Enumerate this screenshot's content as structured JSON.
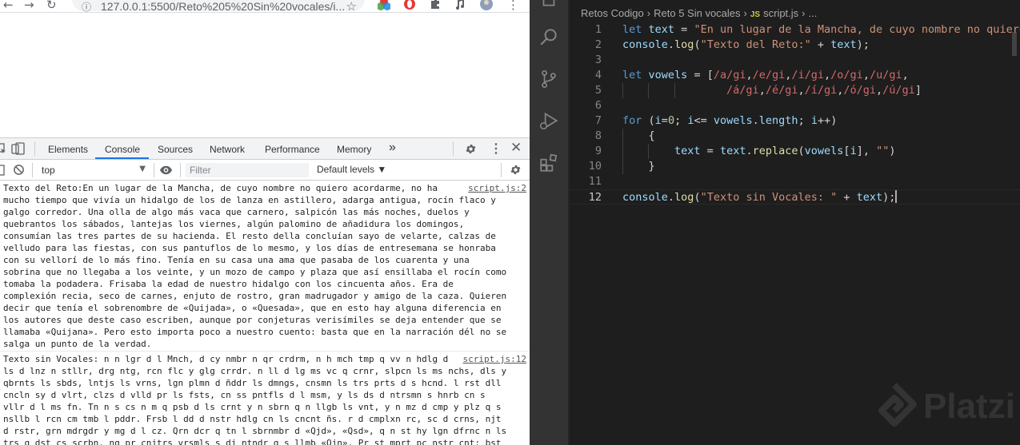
{
  "browser": {
    "url": "127.0.0.1:5500/Reto%205%20Sin%20vocales/i...",
    "colors": {
      "toolbar": "#ffffff",
      "omnibox": "#f1f3f4"
    }
  },
  "devtools": {
    "tabs": [
      "Elements",
      "Console",
      "Sources",
      "Network",
      "Performance",
      "Memory"
    ],
    "active_tab": "Console",
    "more_tabs": "»",
    "context": "top",
    "filter_placeholder": "Filter",
    "levels": "Default levels ▼",
    "accent": "#1a73e8"
  },
  "console": {
    "messages": [
      {
        "source": "script.js:2",
        "text": "Texto del Reto:En un lugar de la Mancha, de cuyo nombre no quiero acordarme, no ha mucho tiempo que vivía un hidalgo de los de lanza en astillero, adarga antigua, rocín flaco y galgo corredor. Una olla de algo más vaca que carnero, salpicón las más noches, duelos y quebrantos los sábados, lantejas los viernes, algún palomino de añadidura los domingos, consumían las tres partes de su hacienda. El resto della concluían sayo de velarte, calzas de velludo para las fiestas, con sus pantuflos de lo mesmo, y los días de entresemana se honraba con su vellorí de lo más fino. Tenía en su casa una ama que pasaba de los cuarenta y una sobrina que no llegaba a los veinte, y un mozo de campo y plaza que así ensillaba el rocín como tomaba la podadera. Frisaba la edad de nuestro hidalgo con los cincuenta años. Era de complexión recia, seco de carnes, enjuto de rostro, gran madrugador y amigo de la caza. Quieren decir que tenía el sobrenombre de «Quijada», o «Quesada», que en esto hay alguna diferencia en los autores que deste caso escriben, aunque por conjeturas verisímiles se deja entender que se llamaba «Quijana». Pero esto importa poco a nuestro cuento: basta que en la narración dél no se salga un punto de la verdad."
      },
      {
        "source": "script.js:12",
        "text": "Texto sin Vocales: n n lgr d l Mnch, d cy nmbr n qr crdrm, n h mch tmp q vv n hdlg d ls d lnz n stllr, drg ntg, rcn flc y glg crrdr. n ll d lg ms vc q crnr, slpcn ls ms nchs, dls y qbrnts ls sbds, lntjs ls vrns, lgn plmn d ñddr ls dmngs, cnsmn ls trs prts d s hcnd. l rst dll cncln sy d vlrt, clzs d vlld pr ls fsts, cn ss pntfls d l msm, y ls ds d ntrsmn s hnrb cn s vllr d l ms fn. Tn n s cs n m q psb d ls crnt y n sbrn q n llgb  ls vnt, y n mz d cmp y plz q s nsllb l rcn cm tmb l pddr. Frsb l dd d nstr hdlg cn ls cncnt ñs. r d cmplxn rc, sc d crns, njt d rstr, grn mdrgdr y mg d l cz. Qrn dcr q tn l sbrnmbr d «Qjd»,  «Qsd», q n st hy lgn dfrnc n ls trs q dst cs scrbn, nq pr cnjtrs vrsmls s dj ntndr q s llmb «Qjn». Pr st mprt pc  nstr cnt: bst q n l nrrcn dl n s slg n pnt d l vrdd."
      }
    ]
  },
  "vscode": {
    "breadcrumbs": [
      "Retos Codigo",
      "Reto 5 Sin vocales",
      "script.js",
      "..."
    ],
    "file_badge": "JS",
    "lines": [
      {
        "n": "1",
        "tokens": [
          [
            "kw",
            "let"
          ],
          [
            "pl",
            " "
          ],
          [
            "var",
            "text"
          ],
          [
            "pl",
            " = "
          ],
          [
            "str",
            "\"En un lugar de la Mancha, de cuyo nombre no quiero"
          ]
        ]
      },
      {
        "n": "2",
        "tokens": [
          [
            "var",
            "console"
          ],
          [
            "pl",
            "."
          ],
          [
            "fn",
            "log"
          ],
          [
            "pl",
            "("
          ],
          [
            "str",
            "\"Texto del Reto:\""
          ],
          [
            "pl",
            " + "
          ],
          [
            "var",
            "text"
          ],
          [
            "pl",
            ");"
          ]
        ]
      },
      {
        "n": "3",
        "tokens": []
      },
      {
        "n": "4",
        "tokens": [
          [
            "kw",
            "let"
          ],
          [
            "pl",
            " "
          ],
          [
            "var",
            "vowels"
          ],
          [
            "pl",
            " = ["
          ],
          [
            "rx",
            "/a/gi"
          ],
          [
            "pl",
            ","
          ],
          [
            "rx",
            "/e/gi"
          ],
          [
            "pl",
            ","
          ],
          [
            "rx",
            "/i/gi"
          ],
          [
            "pl",
            ","
          ],
          [
            "rx",
            "/o/gi"
          ],
          [
            "pl",
            ","
          ],
          [
            "rx",
            "/u/gi"
          ],
          [
            "pl",
            ","
          ]
        ]
      },
      {
        "n": "5",
        "tokens": [
          [
            "pl",
            "                "
          ],
          [
            "rx",
            "/á/gi"
          ],
          [
            "pl",
            ","
          ],
          [
            "rx",
            "/é/gi"
          ],
          [
            "pl",
            ","
          ],
          [
            "rx",
            "/í/gi"
          ],
          [
            "pl",
            ","
          ],
          [
            "rx",
            "/ó/gi"
          ],
          [
            "pl",
            ","
          ],
          [
            "rx",
            "/ú/gi"
          ],
          [
            "pl",
            "]"
          ]
        ]
      },
      {
        "n": "6",
        "tokens": []
      },
      {
        "n": "7",
        "tokens": [
          [
            "kw",
            "for"
          ],
          [
            "pl",
            " ("
          ],
          [
            "var",
            "i"
          ],
          [
            "pl",
            "="
          ],
          [
            "num",
            "0"
          ],
          [
            "pl",
            "; "
          ],
          [
            "var",
            "i"
          ],
          [
            "pl",
            "<= "
          ],
          [
            "var",
            "vowels"
          ],
          [
            "pl",
            "."
          ],
          [
            "var",
            "length"
          ],
          [
            "pl",
            "; "
          ],
          [
            "var",
            "i"
          ],
          [
            "pl",
            "++)"
          ]
        ]
      },
      {
        "n": "8",
        "tokens": [
          [
            "pl",
            "    {"
          ]
        ]
      },
      {
        "n": "9",
        "tokens": [
          [
            "pl",
            "        "
          ],
          [
            "var",
            "text"
          ],
          [
            "pl",
            " = "
          ],
          [
            "var",
            "text"
          ],
          [
            "pl",
            "."
          ],
          [
            "fn",
            "replace"
          ],
          [
            "pl",
            "("
          ],
          [
            "var",
            "vowels"
          ],
          [
            "pl",
            "["
          ],
          [
            "var",
            "i"
          ],
          [
            "pl",
            "], "
          ],
          [
            "str",
            "\"\""
          ],
          [
            "pl",
            ")"
          ]
        ]
      },
      {
        "n": "10",
        "tokens": [
          [
            "pl",
            "    }"
          ]
        ]
      },
      {
        "n": "11",
        "tokens": []
      },
      {
        "n": "12",
        "tokens": [
          [
            "var",
            "console"
          ],
          [
            "pl",
            "."
          ],
          [
            "fn",
            "log"
          ],
          [
            "pl",
            "("
          ],
          [
            "str",
            "\"Texto sin Vocales: \""
          ],
          [
            "pl",
            " + "
          ],
          [
            "var",
            "text"
          ],
          [
            "pl",
            ");"
          ]
        ]
      }
    ],
    "active_line": "12",
    "colors": {
      "editor_bg": "#1e1e1e",
      "activity_bar": "#333333",
      "keyword": "#569cd6",
      "string": "#ce9178",
      "regex": "#d16969"
    }
  },
  "watermark": {
    "brand": "Platzi"
  }
}
